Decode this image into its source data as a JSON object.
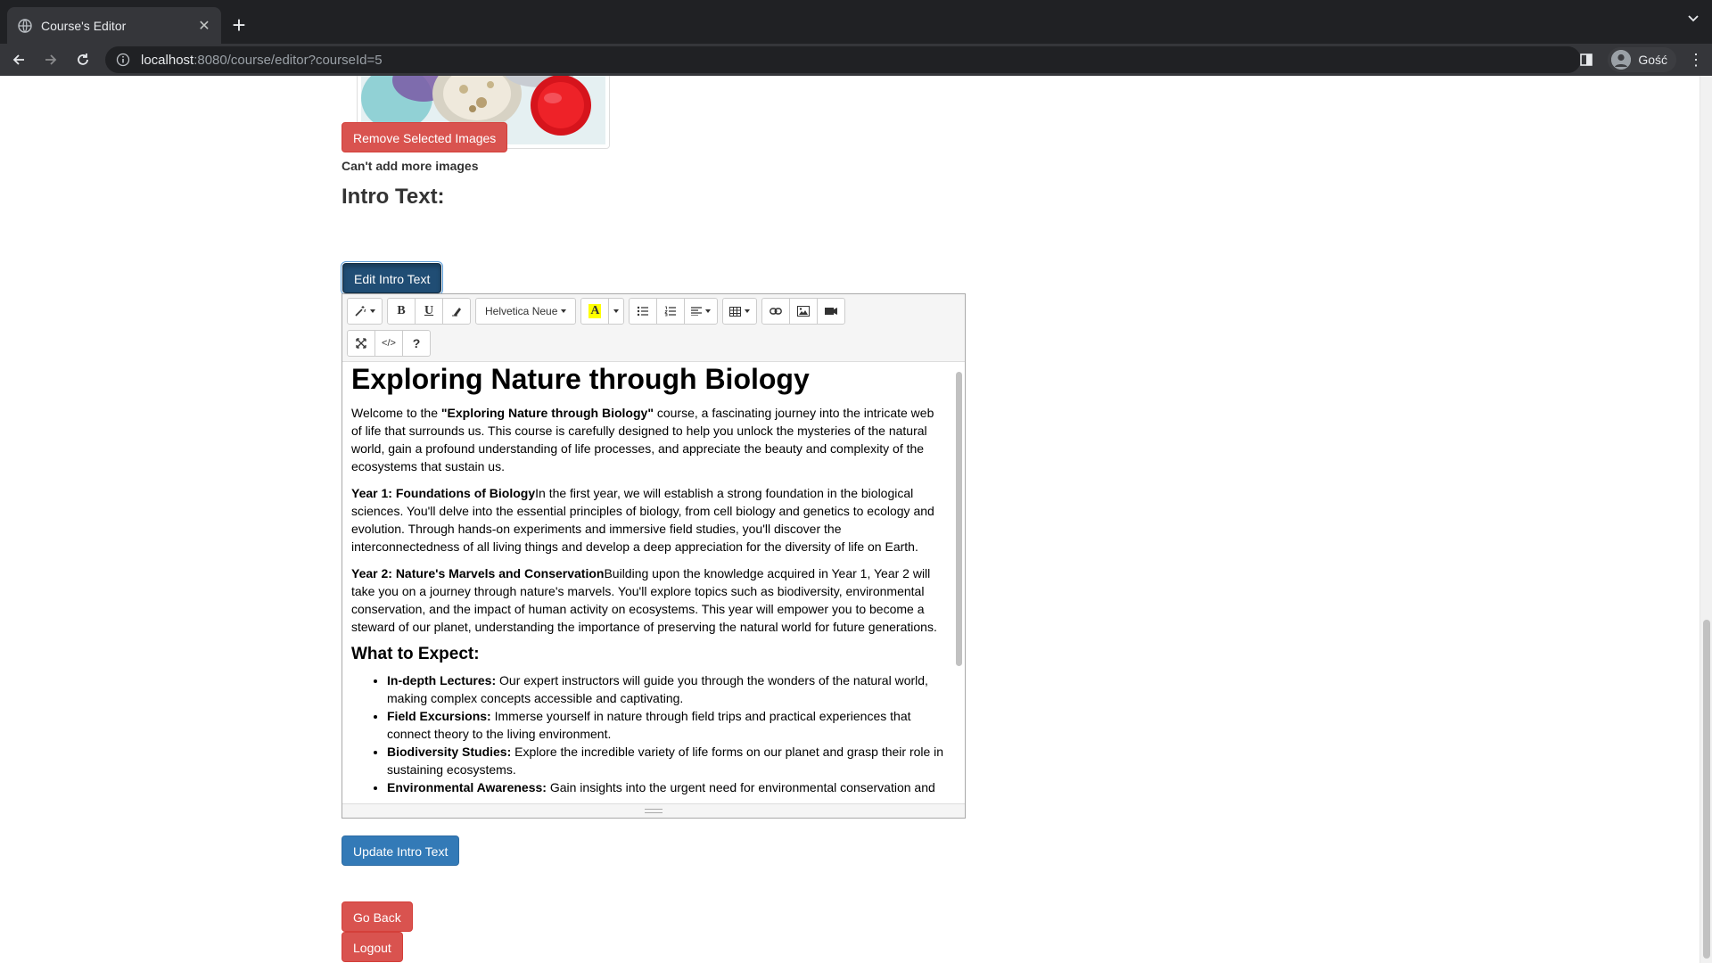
{
  "browser": {
    "tab_title": "Course's Editor",
    "url_host": "localhost",
    "url_path": ":8080/course/editor?courseId=5",
    "profile_name": "Gość"
  },
  "images": {
    "remove_button": "Remove Selected Images",
    "limit_note": "Can't add more images"
  },
  "intro": {
    "heading": "Intro Text:",
    "edit_button": "Edit Intro Text",
    "update_button": "Update Intro Text"
  },
  "editor": {
    "font_name": "Helvetica Neue",
    "toolbar_icons": [
      "magic-style-icon",
      "bold-icon",
      "underline-icon",
      "eraser-icon",
      "font-name-dropdown",
      "text-color-icon",
      "color-caret-icon",
      "unordered-list-icon",
      "ordered-list-icon",
      "paragraph-align-icon",
      "table-icon",
      "link-icon",
      "picture-icon",
      "video-icon",
      "fullscreen-icon",
      "code-view-icon",
      "help-icon"
    ],
    "help_label": "?",
    "bold_label": "B",
    "underline_label": "U",
    "color_label": "A",
    "code_label": "</>",
    "title": "Exploring Nature through Biology",
    "intro_pre": "Welcome to the ",
    "intro_bold": "\"Exploring Nature through Biology\"",
    "intro_post": " course, a fascinating journey into the intricate web of life that surrounds us. This course is carefully designed to help you unlock the mysteries of the natural world, gain a profound understanding of life processes, and appreciate the beauty and complexity of the ecosystems that sustain us.",
    "year1_title": "Year 1: Foundations of Biology",
    "year1_text": "In the first year, we will establish a strong foundation in the biological sciences. You'll delve into the essential principles of biology, from cell biology and genetics to ecology and evolution. Through hands-on experiments and immersive field studies, you'll discover the interconnectedness of all living things and develop a deep appreciation for the diversity of life on Earth.",
    "year2_title": "Year 2: Nature's Marvels and Conservation",
    "year2_text": "Building upon the knowledge acquired in Year 1, Year 2 will take you on a journey through nature's marvels. You'll explore topics such as biodiversity, environmental conservation, and the impact of human activity on ecosystems. This year will empower you to become a steward of our planet, understanding the importance of preserving the natural world for future generations.",
    "expect_heading": "What to Expect:",
    "expect_items": [
      {
        "title": "In-depth Lectures:",
        "text": " Our expert instructors will guide you through the wonders of the natural world, making complex concepts accessible and captivating."
      },
      {
        "title": "Field Excursions:",
        "text": " Immerse yourself in nature through field trips and practical experiences that connect theory to the living environment."
      },
      {
        "title": "Biodiversity Studies:",
        "text": " Explore the incredible variety of life forms on our planet and grasp their role in sustaining ecosystems."
      },
      {
        "title": "Environmental Awareness:",
        "text": " Gain insights into the urgent need for environmental conservation and"
      }
    ]
  },
  "nav": {
    "go_back": "Go Back",
    "logout": "Logout"
  },
  "colors": {
    "danger": "#d9534f",
    "primary": "#337ab7",
    "primary_active": "#204d74"
  }
}
